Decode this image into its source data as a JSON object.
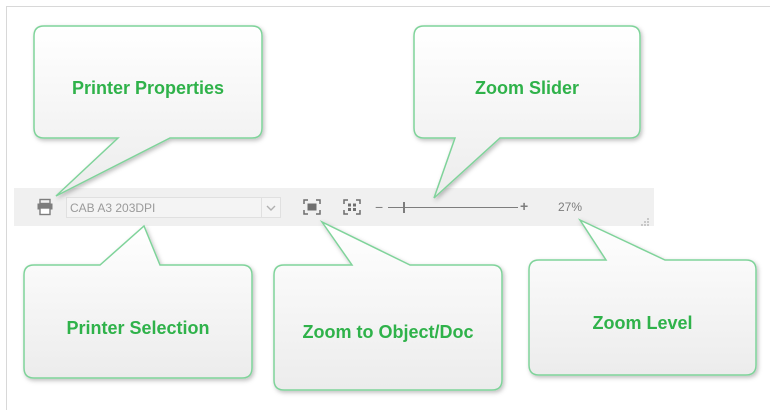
{
  "toolbar": {
    "printer_selection": "CAB A3 203DPI",
    "zoom_minus_glyph": "−",
    "zoom_plus_glyph": "+",
    "zoom_level": "27%",
    "zoom_slider_fraction": 0.12,
    "icons": [
      "printer-icon",
      "chevron-down-icon",
      "zoom-to-object-icon",
      "zoom-to-document-icon",
      "resize-grip-icon"
    ]
  },
  "callouts": {
    "printer_properties": "Printer Properties",
    "zoom_slider": "Zoom Slider",
    "printer_selection": "Printer Selection",
    "zoom_to_object_doc": "Zoom to Object/Doc",
    "zoom_level": "Zoom Level"
  },
  "colors": {
    "callout_border": "#7fd39a",
    "callout_text": "#2fb24a",
    "toolbar_bg": "#f0f0f0",
    "icon_gray": "#7d7d7d"
  }
}
